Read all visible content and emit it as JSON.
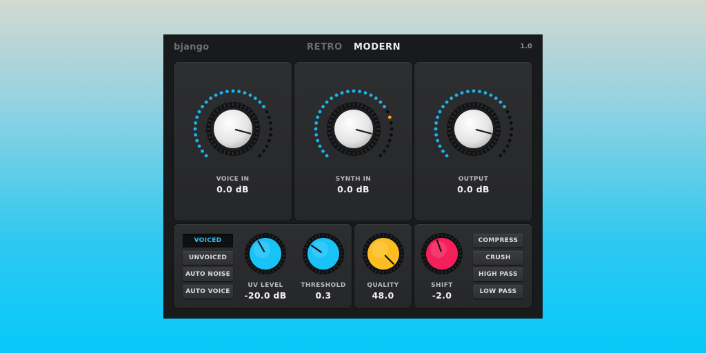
{
  "header": {
    "logo": "bjango",
    "tabs": [
      "RETRO",
      "MODERN"
    ],
    "active_tab": "MODERN",
    "version": "1.0"
  },
  "big_knobs": [
    {
      "label": "VOICE IN",
      "value": "0.0 dB",
      "level": 0.72,
      "extra_led": false
    },
    {
      "label": "SYNTH IN",
      "value": "0.0 dB",
      "level": 0.72,
      "extra_led": true
    },
    {
      "label": "OUTPUT",
      "value": "0.0 dB",
      "level": 0.72,
      "extra_led": false
    }
  ],
  "mode_buttons": [
    {
      "label": "VOICED",
      "active": true
    },
    {
      "label": "UNVOICED",
      "active": false
    },
    {
      "label": "AUTO NOISE",
      "active": false
    },
    {
      "label": "AUTO VOICE",
      "active": false
    }
  ],
  "small_knobs": [
    {
      "label": "UV LEVEL",
      "value": "-20.0 dB",
      "color": "#19c2f7"
    },
    {
      "label": "THRESHOLD",
      "value": "0.3",
      "color": "#19c2f7"
    },
    {
      "label": "QUALITY",
      "value": "48.0",
      "color": "#fbbd22"
    },
    {
      "label": "SHIFT",
      "value": "-2.0",
      "color": "#f51f5c"
    }
  ],
  "effect_buttons": [
    {
      "label": "COMPRESS"
    },
    {
      "label": "CRUSH"
    },
    {
      "label": "HIGH PASS"
    },
    {
      "label": "LOW PASS"
    }
  ],
  "colors": {
    "led_on": "#19b6f0",
    "led_off": "#0d0e0f",
    "led_peak": "#f4a623",
    "accent": "#22c6f7"
  }
}
